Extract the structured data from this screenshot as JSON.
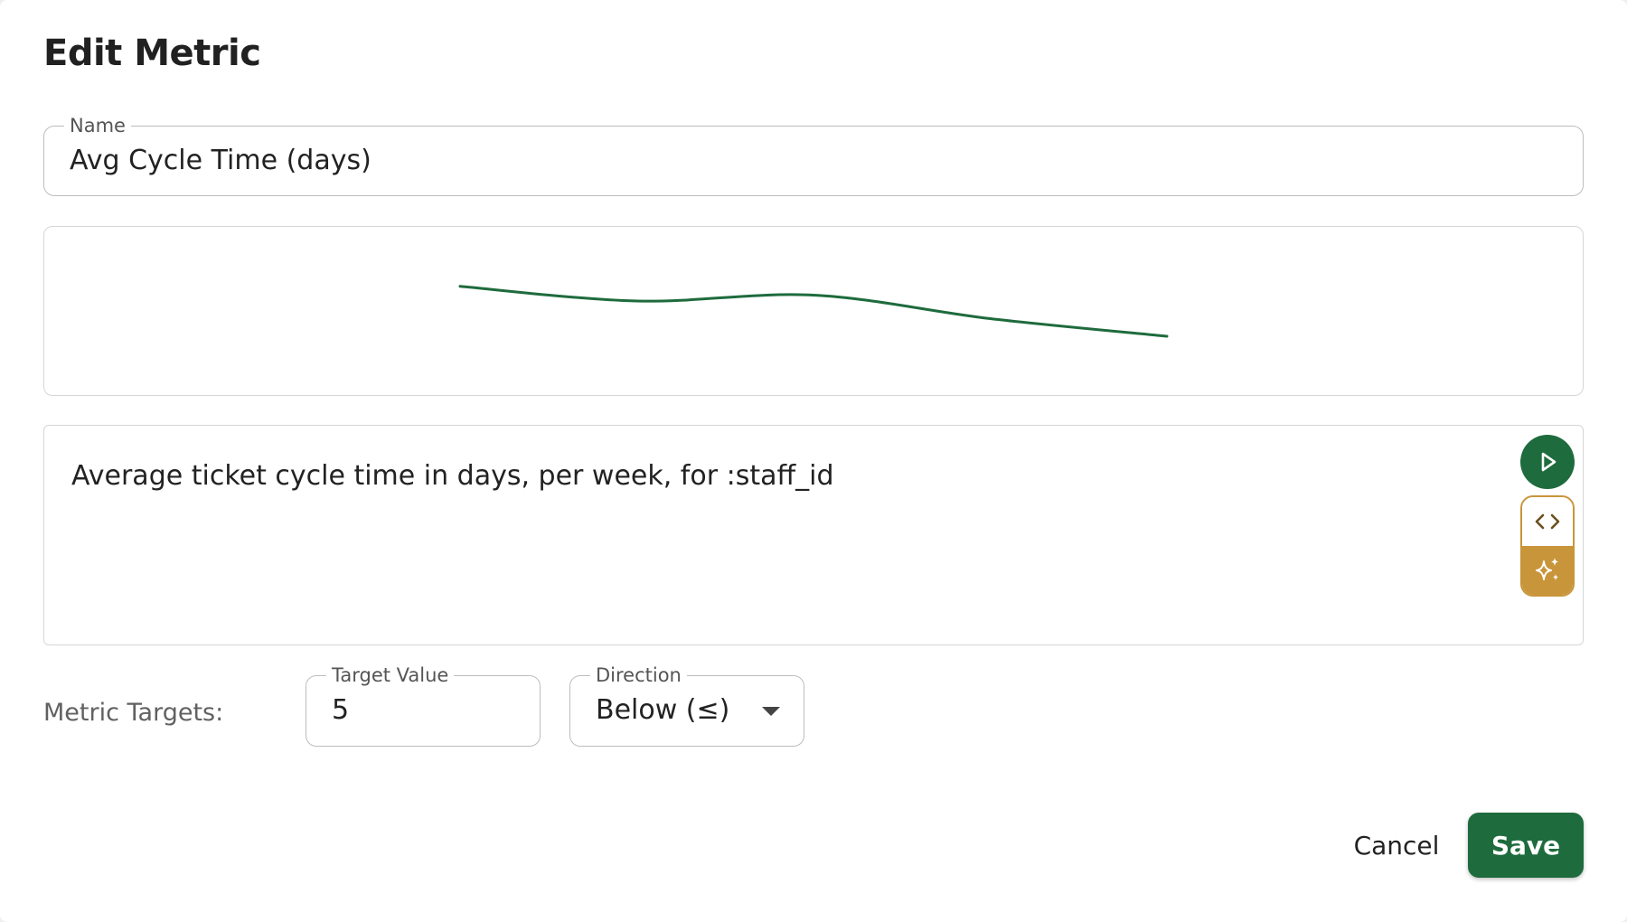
{
  "dialog": {
    "title": "Edit Metric"
  },
  "name_field": {
    "label": "Name",
    "value": "Avg Cycle Time (days)"
  },
  "chart_data": {
    "type": "line",
    "title": "",
    "xlabel": "",
    "ylabel": "",
    "grid": false,
    "series": [
      {
        "values": [
          5.9,
          5.4,
          5.6,
          4.8,
          4.2
        ]
      }
    ],
    "ylim": [
      3.0,
      7.0
    ],
    "color": "#1e6b3d"
  },
  "query": {
    "text": "Average ticket cycle time in days, per week, for :staff_id",
    "run_icon": "play-icon",
    "code_icon": "code-brackets-icon",
    "ai_icon": "sparkle-icon"
  },
  "targets": {
    "label": "Metric Targets:",
    "target_value_label": "Target Value",
    "target_value": "5",
    "direction_label": "Direction",
    "direction_value": "Below (≤)"
  },
  "actions": {
    "cancel_label": "Cancel",
    "save_label": "Save"
  },
  "colors": {
    "primary": "#1e6b3d",
    "accent": "#c9953a"
  }
}
